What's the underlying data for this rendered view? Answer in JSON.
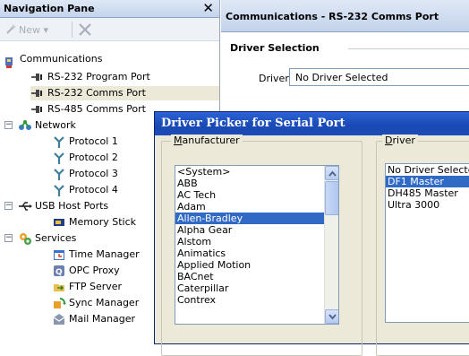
{
  "nav": {
    "title": "Navigation Pane",
    "close_symbol": "✕",
    "toolbar": {
      "new_label": "New",
      "new_icon": "wand-icon",
      "delete_icon": "delete-x-icon"
    },
    "tree": {
      "communications": "Communications",
      "rs232_program": "RS-232 Program Port",
      "rs232_comms": "RS-232 Comms Port",
      "rs485_comms": "RS-485 Comms Port",
      "network": "Network",
      "protocol1": "Protocol 1",
      "protocol2": "Protocol 2",
      "protocol3": "Protocol 3",
      "protocol4": "Protocol 4",
      "usb_host": "USB Host Ports",
      "memory_stick": "Memory Stick",
      "services": "Services",
      "time_manager": "Time Manager",
      "opc_proxy": "OPC Proxy",
      "ftp_server": "FTP Server",
      "sync_manager": "Sync Manager",
      "mail_manager": "Mail Manager",
      "expand_symbol": "⊟"
    }
  },
  "main": {
    "title": "Communications - RS-232 Comms Port",
    "group_title": "Driver Selection",
    "driver_label": "Driver:",
    "driver_value": "No Driver Selected"
  },
  "dialog": {
    "title": "Driver Picker for Serial Port",
    "manufacturer_label_u": "M",
    "manufacturer_label_rest": "anufacturer",
    "driver_label_u": "D",
    "driver_label_rest": "river",
    "manufacturers": [
      "<System>",
      "ABB",
      "AC Tech",
      "Adam",
      "Allen-Bradley",
      "Alpha Gear",
      "Alstom",
      "Animatics",
      "Applied Motion",
      "BACnet",
      "Caterpillar",
      "Contrex"
    ],
    "manufacturer_selected": "Allen-Bradley",
    "drivers": [
      "No Driver Selected",
      "DF1 Master",
      "DH485 Master",
      "Ultra 3000"
    ],
    "driver_selected": "DF1 Master"
  },
  "colors": {
    "selection": "#316ac5",
    "titlebar": "#1a49b4",
    "header_gradient": "#c3d3ec",
    "tree_selection": "#ece9d8"
  }
}
